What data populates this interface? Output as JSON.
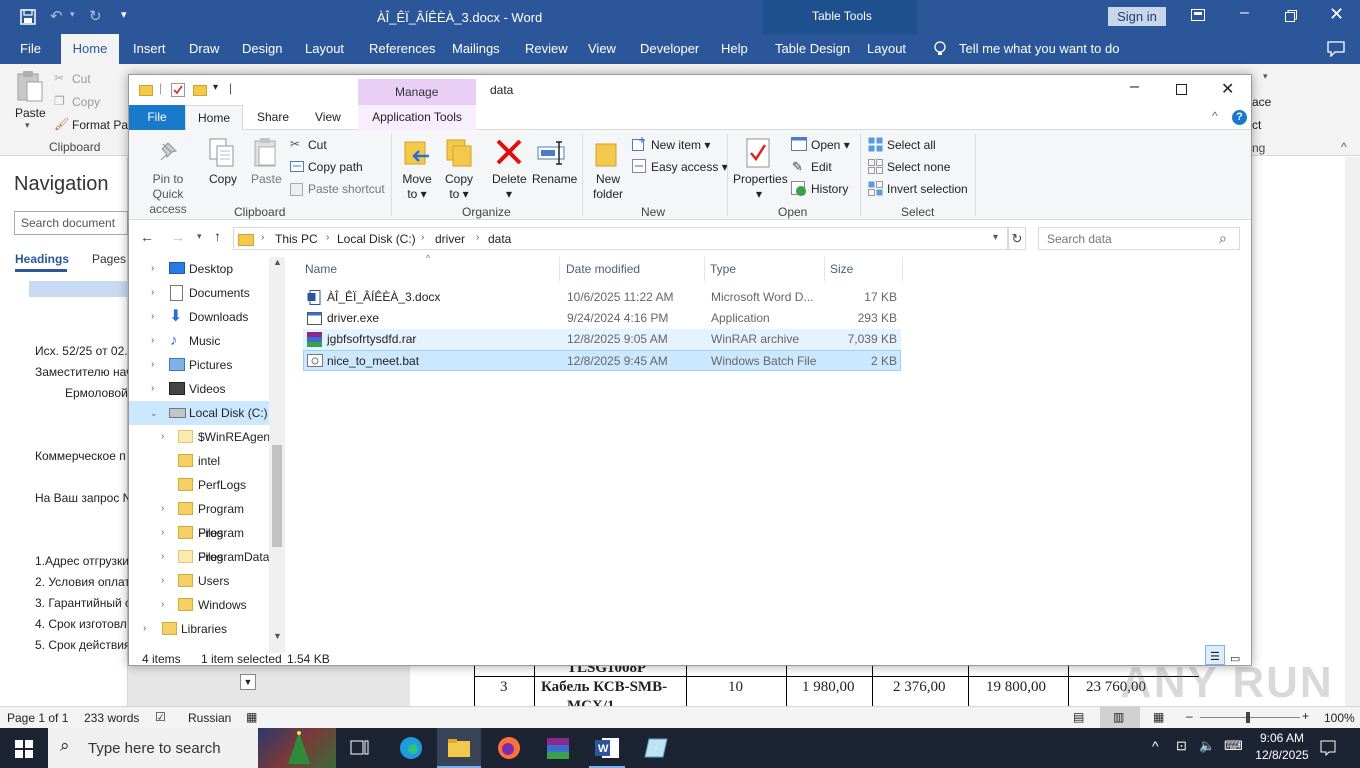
{
  "word": {
    "title": "ÀÎ_ÊÏ_ÂÍÊÈÀ_3.docx  -  Word",
    "table_tools": "Table Tools",
    "sign_in": "Sign in",
    "tabs": [
      "File",
      "Home",
      "Insert",
      "Draw",
      "Design",
      "Layout",
      "References",
      "Mailings",
      "Review",
      "View",
      "Developer",
      "Help",
      "Table Design",
      "Layout"
    ],
    "tell_me": "Tell me what you want to do",
    "clipboard": {
      "paste": "Paste",
      "cut": "Cut",
      "copy": "Copy",
      "format_painter": "Format Pa",
      "group": "Clipboard"
    },
    "right_ribbon": {
      "ace": "ace",
      "ct": "ct",
      "ng": "ng"
    },
    "nav": {
      "title": "Navigation",
      "search_placeholder": "Search document",
      "tab_headings": "Headings",
      "tab_pages": "Pages"
    },
    "doc_lines": [
      "Исх. 52/25 от 02.1",
      "Заместителю нач",
      "Ермоловой",
      "Коммерческое п",
      "На Ваш запрос N",
      "1.Адрес отгрузки",
      "2. Условия оплат",
      "3. Гарантийный с",
      "4. Срок изготовл",
      "5. Срок действия"
    ],
    "table_row": {
      "cut_top": "TLSG1008P",
      "num": "3",
      "name": "Кабель КСВ-SMB-",
      "name2": "MCX/1",
      "qty": "10",
      "price": "1 980,00",
      "price_vat": "2 376,00",
      "sum": "19 800,00",
      "sum_vat": "23 760,00"
    },
    "status": {
      "page": "Page 1 of 1",
      "words": "233 words",
      "lang": "Russian",
      "zoom": "100%"
    }
  },
  "explorer": {
    "title": "data",
    "manage": "Manage",
    "tabs": {
      "file": "File",
      "home": "Home",
      "share": "Share",
      "view": "View",
      "app_tools": "Application Tools"
    },
    "ribbon": {
      "pin": "Pin to Quick",
      "pin2": "access",
      "copy": "Copy",
      "paste": "Paste",
      "cut": "Cut",
      "copy_path": "Copy path",
      "paste_shortcut": "Paste shortcut",
      "clipboard": "Clipboard",
      "move_to": "Move",
      "move_to2": "to",
      "copy_to": "Copy",
      "copy_to2": "to",
      "delete": "Delete",
      "rename": "Rename",
      "organize": "Organize",
      "new_folder": "New",
      "new_folder2": "folder",
      "new_item": "New item",
      "easy_access": "Easy access",
      "new": "New",
      "properties": "Properties",
      "open": "Open",
      "edit": "Edit",
      "history": "History",
      "open_group": "Open",
      "select_all": "Select all",
      "select_none": "Select none",
      "invert_selection": "Invert selection",
      "select": "Select"
    },
    "breadcrumb": [
      "This PC",
      "Local Disk (C:)",
      "driver",
      "data"
    ],
    "search_placeholder": "Search data",
    "tree": [
      {
        "label": "Desktop",
        "icon": "desktop-icon"
      },
      {
        "label": "Documents",
        "icon": "documents-icon"
      },
      {
        "label": "Downloads",
        "icon": "downloads-icon"
      },
      {
        "label": "Music",
        "icon": "music-icon"
      },
      {
        "label": "Pictures",
        "icon": "pictures-icon"
      },
      {
        "label": "Videos",
        "icon": "videos-icon"
      },
      {
        "label": "Local Disk (C:)",
        "icon": "drive-icon"
      },
      {
        "label": "$WinREAgent",
        "icon": "folder-icon"
      },
      {
        "label": "intel",
        "icon": "folder-icon"
      },
      {
        "label": "PerfLogs",
        "icon": "folder-icon"
      },
      {
        "label": "Program Files",
        "icon": "folder-icon"
      },
      {
        "label": "Program Files",
        "icon": "folder-icon"
      },
      {
        "label": "ProgramData",
        "icon": "folder-icon"
      },
      {
        "label": "Users",
        "icon": "folder-icon"
      },
      {
        "label": "Windows",
        "icon": "folder-icon"
      },
      {
        "label": "Libraries",
        "icon": "libraries-icon"
      }
    ],
    "columns": {
      "name": "Name",
      "date": "Date modified",
      "type": "Type",
      "size": "Size"
    },
    "files": [
      {
        "name": "ÀÎ_ÊÏ_ÂÍÊÈÀ_3.docx",
        "date": "10/6/2025 11:22 AM",
        "type": "Microsoft Word D...",
        "size": "17 KB",
        "icon": "word-doc-icon"
      },
      {
        "name": "driver.exe",
        "date": "9/24/2024 4:16 PM",
        "type": "Application",
        "size": "293 KB",
        "icon": "exe-icon"
      },
      {
        "name": "jgbfsofrtysdfd.rar",
        "date": "12/8/2025 9:05 AM",
        "type": "WinRAR archive",
        "size": "7,039 KB",
        "icon": "rar-icon"
      },
      {
        "name": "nice_to_meet.bat",
        "date": "12/8/2025 9:45 AM",
        "type": "Windows Batch File",
        "size": "2 KB",
        "icon": "bat-icon"
      }
    ],
    "status": {
      "items": "4 items",
      "selected": "1 item selected",
      "size": "1.54 KB"
    }
  },
  "taskbar": {
    "search_placeholder": "Type here to search",
    "time": "9:06 AM",
    "date": "12/8/2025"
  },
  "watermark": "ANY RUN",
  "colors": {
    "word_blue": "#2b579a",
    "manage_bg": "#e9cff6",
    "selection": "#cce8ff",
    "hover": "#e5f3ff",
    "taskbar": "#1c2433"
  }
}
